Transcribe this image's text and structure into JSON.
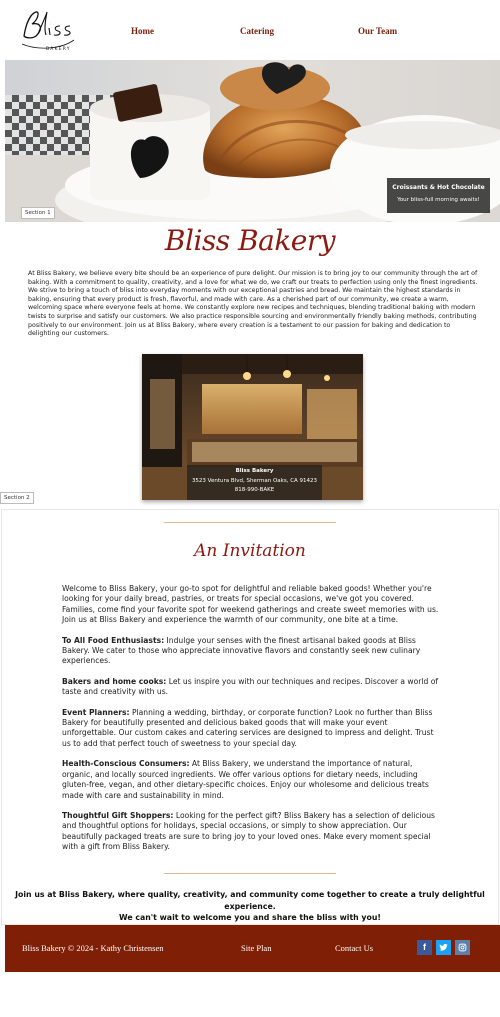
{
  "header": {
    "logo_text": "Bliss",
    "logo_sub": "BAKERY",
    "nav": [
      {
        "label": "Home"
      },
      {
        "label": "Catering"
      },
      {
        "label": "Our Team"
      }
    ]
  },
  "hero": {
    "caption_title": "Croissants & Hot Chocolate",
    "caption_sub": "Your bliss-full morning awaits!",
    "section_label": "Section 1"
  },
  "about": {
    "title": "Bliss Bakery",
    "text": "At Bliss Bakery, we believe every bite should be an experience of pure delight. Our mission is to bring joy to our community through the art of baking. With a commitment to quality, creativity, and a love for what we do, we craft our treats to perfection using only the finest ingredients. We strive to bring a touch of bliss into everyday moments with our exceptional pastries and bread. We maintain the highest standards in baking, ensuring that every product is fresh, flavorful, and made with care. As a cherished part of our community, we create a warm, welcoming space where everyone feels at home. We constantly explore new recipes and techniques, blending traditional baking with modern twists to surprise and satisfy our customers. We also practice responsible sourcing and environmentally friendly baking methods, contributing positively to our environment. Join us at Bliss Bakery, where every creation is a testament to our passion for baking and dedication to delighting our customers."
  },
  "store": {
    "name": "Bliss Bakery",
    "address": "3523 Ventura Blvd, Sherman Oaks, CA 91423",
    "phone": "818-990-BAKE",
    "section_label": "Section 2"
  },
  "invitation": {
    "title": "An Invitation",
    "intro": "Welcome to Bliss Bakery, your go-to spot for delightful and reliable baked goods! Whether you're looking for your daily bread, pastries, or treats for special occasions, we've got you covered. Families, come find your favorite spot for weekend gatherings and create sweet memories with us. Join us at Bliss Bakery and experience the warmth of our community, one bite at a time.",
    "items": [
      {
        "label": "To All Food Enthusiasts:",
        "text": " Indulge your senses with the finest artisanal baked goods at Bliss Bakery. We cater to those who appreciate innovative flavors and constantly seek new culinary experiences."
      },
      {
        "label": "Bakers and home cooks:",
        "text": " Let us inspire you with our techniques and recipes. Discover a world of taste and creativity with us."
      },
      {
        "label": "Event Planners:",
        "text": " Planning a wedding, birthday, or corporate function? Look no further than Bliss Bakery for beautifully presented and delicious baked goods that will make your event unforgettable. Our custom cakes and catering services are designed to impress and delight. Trust us to add that perfect touch of sweetness to your special day."
      },
      {
        "label": "Health-Conscious Consumers:",
        "text": " At Bliss Bakery, we understand the importance of natural, organic, and locally sourced ingredients. We offer various options for dietary needs, including gluten-free, vegan, and other dietary-specific choices. Enjoy our wholesome and delicious treats made with care and sustainability in mind."
      },
      {
        "label": "Thoughtful Gift Shoppers:",
        "text": " Looking for the perfect gift? Bliss Bakery has a selection of delicious and thoughtful options for holidays, special occasions, or simply to show appreciation. Our beautifully packaged treats are sure to bring joy to your loved ones. Make every moment special with a gift from Bliss Bakery."
      }
    ],
    "closing_1": "Join us at Bliss Bakery, where quality, creativity, and community come together to create a truly delightful experience.",
    "closing_2": "We can't wait to welcome you and share the bliss with you!"
  },
  "footer": {
    "copyright": "Bliss Bakery © 2024 - Kathy Christensen",
    "site_plan": "Site Plan",
    "contact": "Contact Us",
    "social": [
      {
        "icon": "facebook-icon",
        "glyph": "f",
        "color": "#3b5a9a"
      },
      {
        "icon": "twitter-icon",
        "color": "#1da1f2"
      },
      {
        "icon": "instagram-icon",
        "color": "#5d7fa8"
      }
    ]
  },
  "colors": {
    "brand": "#8b1a10",
    "footer_bg": "#7e1f06",
    "divider": "#e4b98f"
  }
}
